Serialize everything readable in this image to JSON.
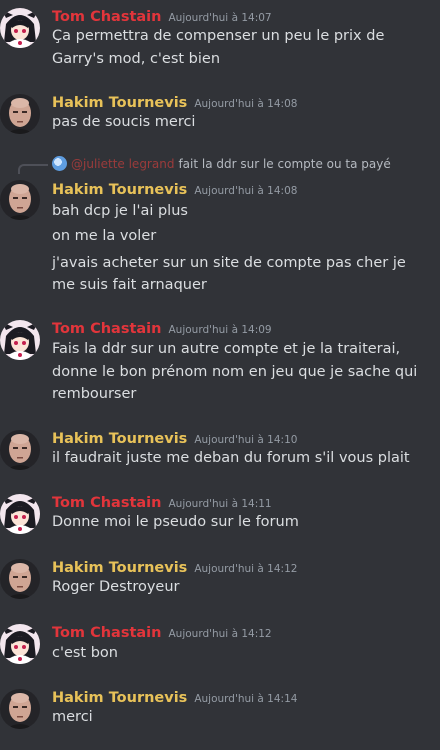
{
  "messages": [
    {
      "author": "Tom Chastain",
      "time": "Aujourd'hui à 14:07",
      "lines": [
        "Ça permettra de compenser un peu le prix de",
        "Garry's mod, c'est bien"
      ]
    },
    {
      "author": "Hakim Tournevis",
      "time": "Aujourd'hui à 14:08",
      "lines": [
        "pas de soucis merci"
      ]
    },
    {
      "reply_name": "@juliette legrand",
      "reply_text": "fait la ddr sur le compte ou ta payé",
      "author": "Hakim Tournevis",
      "time": "Aujourd'hui à 14:08",
      "lines": [
        "bah dcp je l'ai plus",
        "on me la voler",
        "j'avais acheter sur un site de compte pas cher je",
        "me suis fait arnaquer"
      ]
    },
    {
      "author": "Tom Chastain",
      "time": "Aujourd'hui à 14:09",
      "lines": [
        "Fais la ddr sur un autre compte et je la traiterai,",
        "donne le bon prénom nom en jeu que je sache qui",
        "rembourser"
      ]
    },
    {
      "author": "Hakim Tournevis",
      "time": "Aujourd'hui à 14:10",
      "lines": [
        "il faudrait juste me deban du forum s'il vous plait"
      ]
    },
    {
      "author": "Tom Chastain",
      "time": "Aujourd'hui à 14:11",
      "lines": [
        "Donne moi le pseudo sur le forum"
      ]
    },
    {
      "author": "Hakim Tournevis",
      "time": "Aujourd'hui à 14:12",
      "lines": [
        "Roger Destroyeur"
      ]
    },
    {
      "author": "Tom Chastain",
      "time": "Aujourd'hui à 14:12",
      "lines": [
        "c'est bon"
      ]
    },
    {
      "author": "Hakim Tournevis",
      "time": "Aujourd'hui à 14:14",
      "lines": [
        "merci"
      ]
    }
  ],
  "colors": {
    "background": "#313338",
    "tom": "#e2353b",
    "hakim": "#e8c259",
    "text": "#dbdee1",
    "timestamp": "#949ba4"
  },
  "icons": {
    "tom_avatar": "anime-girl-avatar-icon",
    "hakim_avatar": "bald-man-avatar-icon",
    "reply_avatar": "globe-avatar-icon"
  }
}
